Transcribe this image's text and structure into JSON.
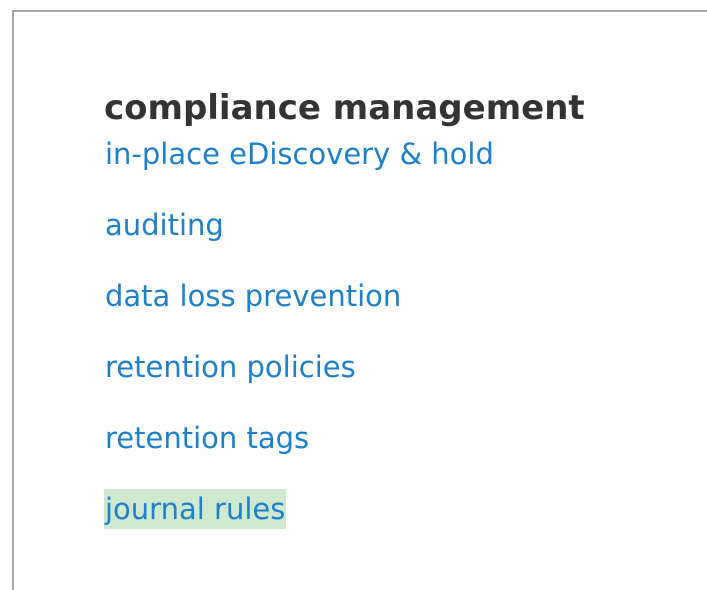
{
  "section": {
    "title": "compliance management",
    "items": [
      {
        "label": "in-place eDiscovery & hold",
        "selected": false
      },
      {
        "label": "auditing",
        "selected": false
      },
      {
        "label": "data loss prevention",
        "selected": false
      },
      {
        "label": "retention policies",
        "selected": false
      },
      {
        "label": "retention tags",
        "selected": false
      },
      {
        "label": "journal rules",
        "selected": true
      }
    ]
  },
  "colors": {
    "link": "#1f7fc9",
    "heading": "#333333",
    "selected_highlight": "#cfe9cf",
    "frame_border": "#a8a8a8"
  }
}
